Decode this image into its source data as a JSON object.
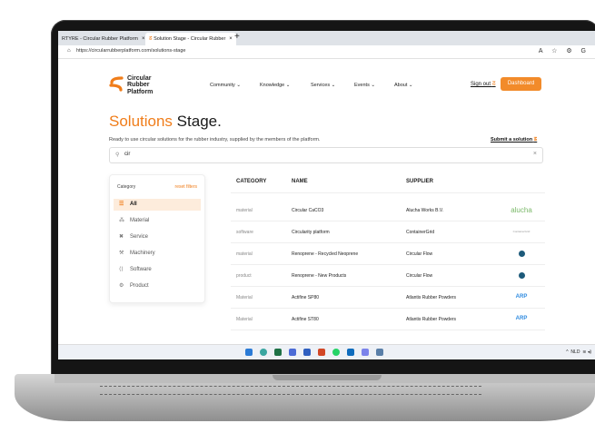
{
  "browser": {
    "tab1": "RTYRE - Circular Rubber Platform",
    "tab2": "Solution Stage - Circular Rubber",
    "url": "https://circularrubberplatform.com/solutions-stage"
  },
  "header": {
    "logo_line1": "Circular",
    "logo_line2": "Rubber",
    "logo_line3": "Platform",
    "nav": [
      "Community ⌄",
      "Knowledge ⌄",
      "Services ⌄",
      "Events ⌄",
      "About ⌄"
    ],
    "sign_out": "Sign out",
    "dashboard": "Dashboard"
  },
  "page": {
    "title_accent": "Solutions",
    "title_rest": "Stage.",
    "subtitle": "Ready to use circular solutions for the rubber industry, supplied by the members of the platform.",
    "submit_link": "Submit a solution",
    "search_value": "cir"
  },
  "filters": {
    "category_label": "Category",
    "reset": "reset filters",
    "items": [
      {
        "label": "All",
        "icon": "filter-icon"
      },
      {
        "label": "Material",
        "icon": "material-icon"
      },
      {
        "label": "Service",
        "icon": "service-icon"
      },
      {
        "label": "Machinery",
        "icon": "machinery-icon"
      },
      {
        "label": "Software",
        "icon": "software-icon"
      },
      {
        "label": "Product",
        "icon": "product-icon"
      }
    ]
  },
  "table": {
    "headers": [
      "CATEGORY",
      "NAME",
      "SUPPLIER"
    ],
    "rows": [
      {
        "category": "material",
        "name": "Circular CaCO3",
        "supplier": "Alucha Works B.V.",
        "logo": "alucha"
      },
      {
        "category": "software",
        "name": "Circularity platform",
        "supplier": "ContainerGrid",
        "logo": "ContainerGrid"
      },
      {
        "category": "material",
        "name": "Renoprene - Recycled Neoprene",
        "supplier": "Circular Flow",
        "logo": ""
      },
      {
        "category": "product",
        "name": "Renoprene - New Products",
        "supplier": "Circular Flow",
        "logo": ""
      },
      {
        "category": "Material",
        "name": "Actifine SP80",
        "supplier": "Atlantis Rubber Powders",
        "logo": "ARP"
      },
      {
        "category": "Material",
        "name": "Actifine ST80",
        "supplier": "Atlantis Rubber Powders",
        "logo": "ARP"
      }
    ]
  },
  "taskbar": {
    "language": "NLD"
  },
  "colors": {
    "accent": "#f07d1a",
    "button": "#f28b2a"
  }
}
